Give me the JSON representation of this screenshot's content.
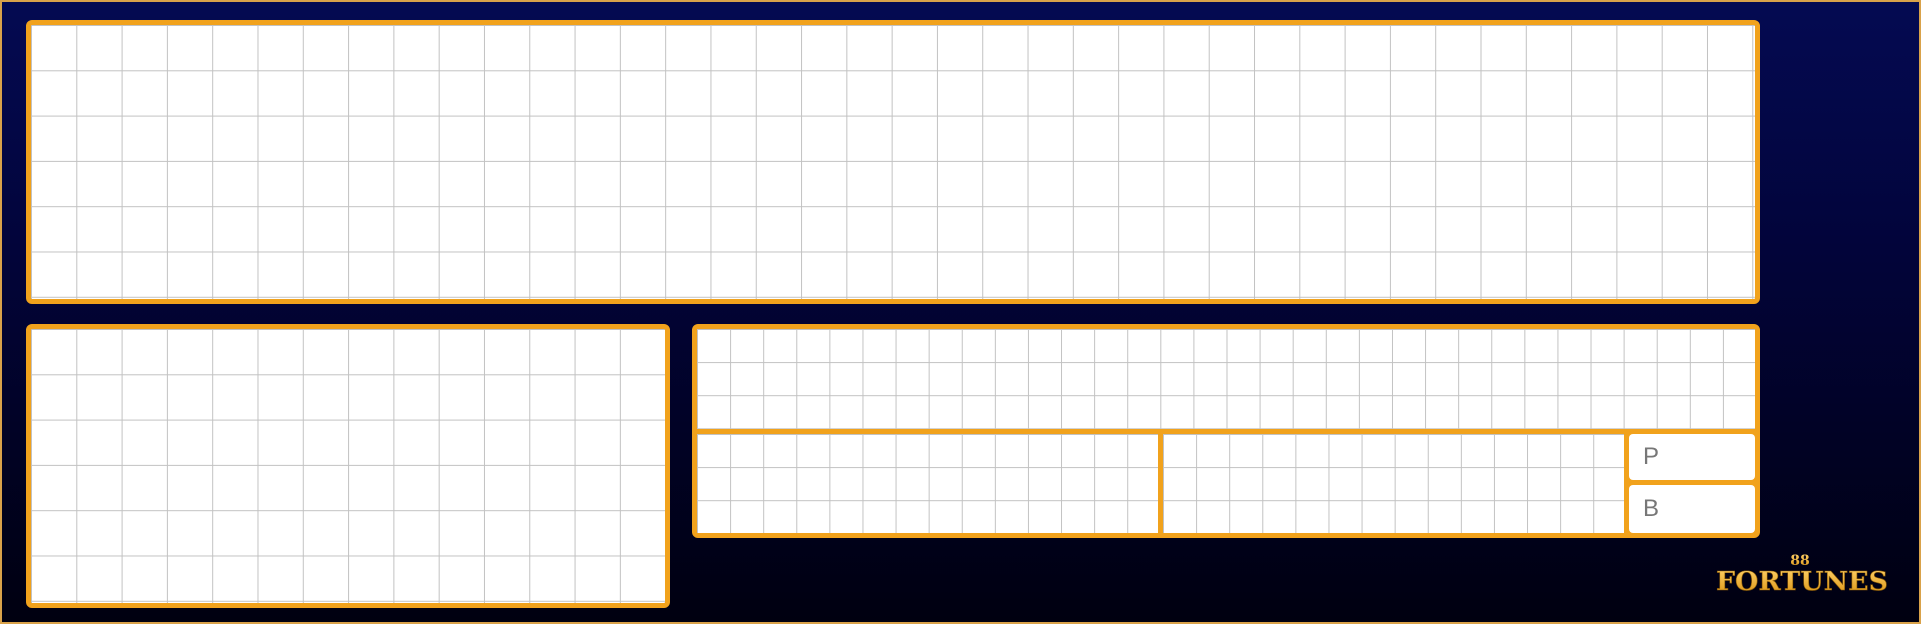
{
  "predict": {
    "player_label": "P",
    "banker_label": "B"
  },
  "logo": {
    "number": "88",
    "word": "FORTUNES"
  },
  "colors": {
    "background_top": "#040a52",
    "background_bottom": "#000010",
    "panel_border": "#f1a21c",
    "grid_line": "#c2c2c2"
  }
}
